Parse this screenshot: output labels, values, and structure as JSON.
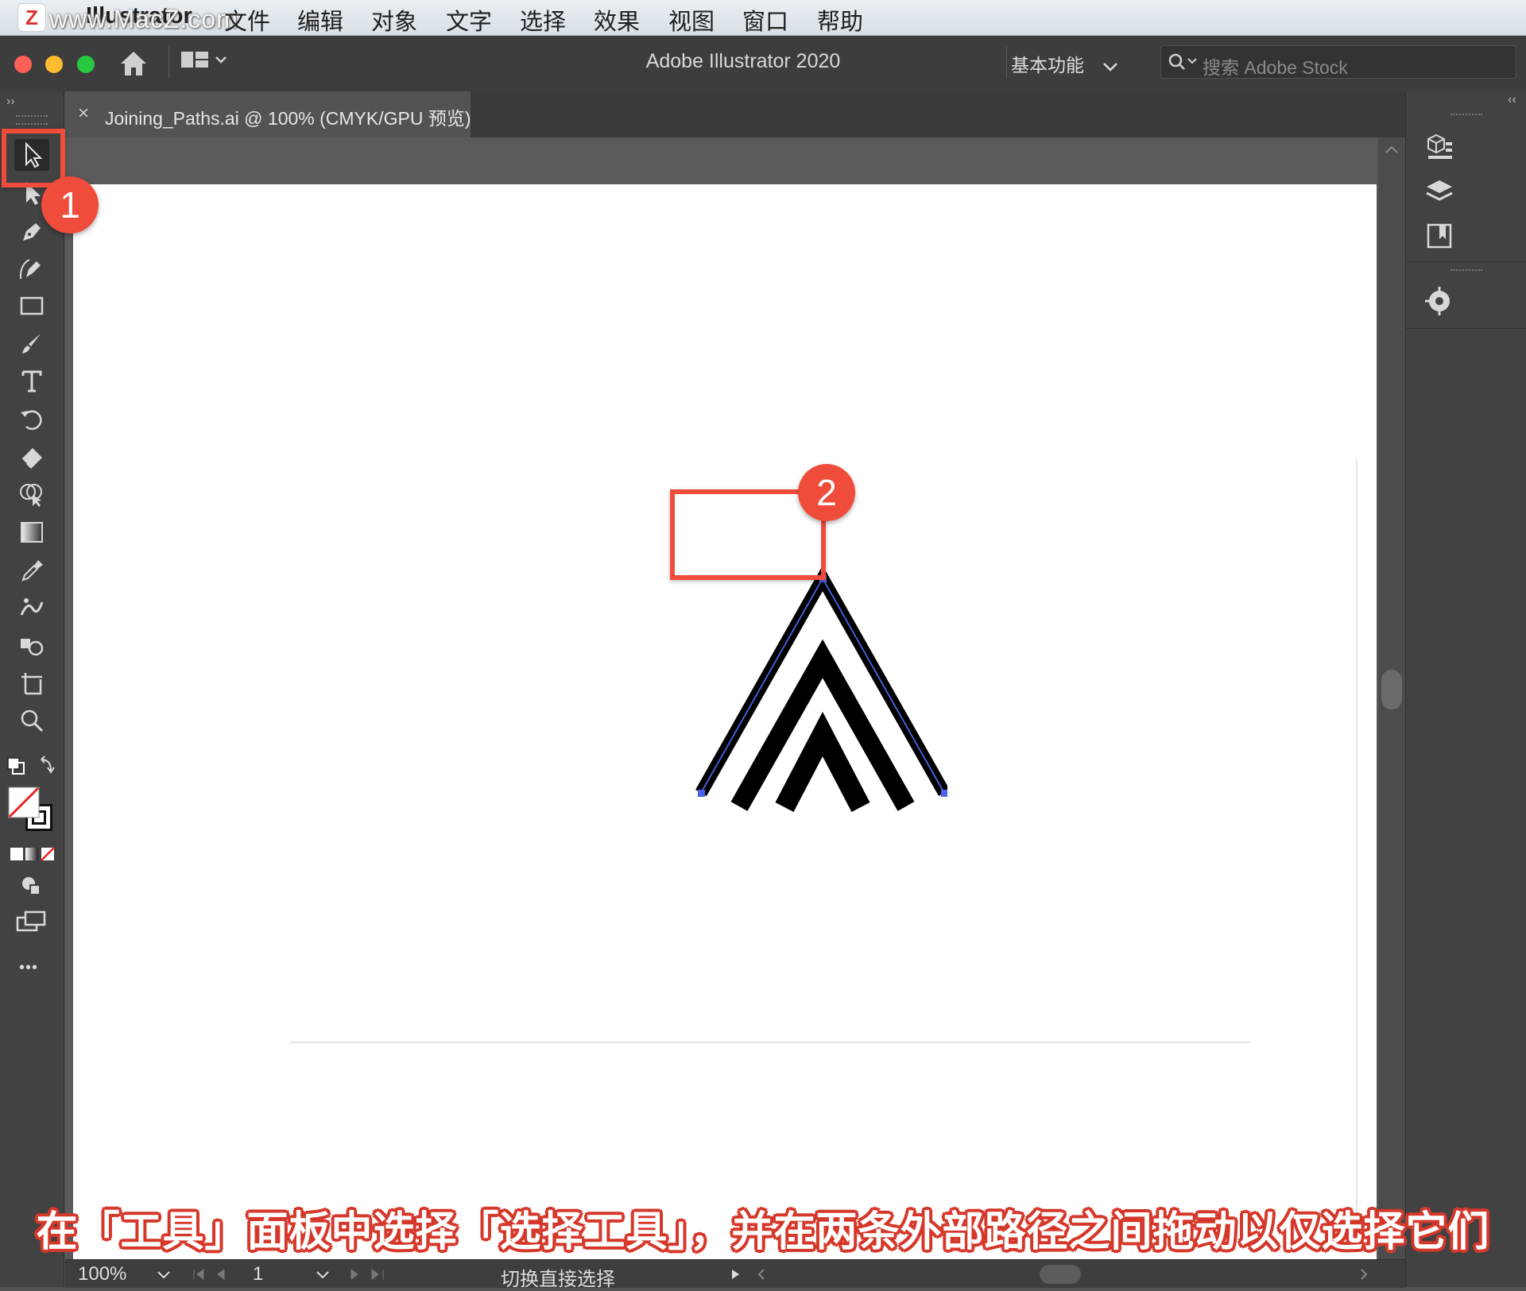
{
  "menubar": {
    "app_name": "Illustrator",
    "watermark": "www.MacZ.com",
    "items": [
      "文件",
      "编辑",
      "对象",
      "文字",
      "选择",
      "效果",
      "视图",
      "窗口",
      "帮助"
    ]
  },
  "titlebar": {
    "title": "Adobe Illustrator 2020",
    "workspace": "基本功能",
    "search_placeholder": "搜索 Adobe Stock"
  },
  "document_tab": {
    "label": "Joining_Paths.ai @ 100% (CMYK/GPU 预览)",
    "close_glyph": "×"
  },
  "toolbar": {
    "tools": [
      "selection-tool",
      "direct-selection-tool",
      "pen-tool",
      "curvature-tool",
      "rectangle-tool",
      "paintbrush-tool",
      "type-tool",
      "rotate-tool",
      "eraser-tool",
      "shape-builder-tool",
      "gradient-tool",
      "eyedropper-tool",
      "puppet-warp-tool",
      "symbol-sprayer-tool",
      "artboard-tool",
      "zoom-tool"
    ],
    "more_glyph": "•••"
  },
  "statusbar": {
    "zoom": "100%",
    "artboard_number": "1",
    "status_text": "切换直接选择"
  },
  "annotations": {
    "callout_1": "1",
    "callout_2": "2",
    "subtitle": "在「工具」面板中选择「选择工具」，并在两条外部路径之间拖动以仅选择它们"
  },
  "colors": {
    "accent_red": "#ef4c3c",
    "path_selection_blue": "#4a63e8",
    "artwork": "#000000"
  }
}
